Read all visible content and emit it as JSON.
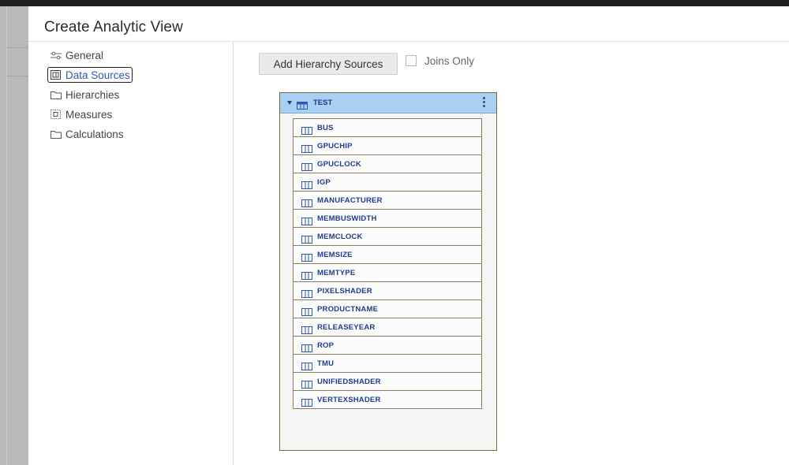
{
  "page": {
    "title": "Create Analytic View"
  },
  "nav": {
    "items": [
      {
        "label": "General",
        "icon": "sliders-icon",
        "active": false
      },
      {
        "label": "Data Sources",
        "icon": "data-sources-icon",
        "active": true
      },
      {
        "label": "Hierarchies",
        "icon": "folder-icon",
        "active": false
      },
      {
        "label": "Measures",
        "icon": "measures-icon",
        "active": false
      },
      {
        "label": "Calculations",
        "icon": "folder-icon",
        "active": false
      }
    ]
  },
  "toolbar": {
    "add_hierarchy_label": "Add Hierarchy Sources",
    "joins_only_label": "Joins Only",
    "joins_only_checked": false
  },
  "source_table": {
    "name": "TEST",
    "menu_icon": "kebab-icon",
    "columns": [
      "BUS",
      "GPUCHIP",
      "GPUCLOCK",
      "IGP",
      "MANUFACTURER",
      "MEMBUSWIDTH",
      "MEMCLOCK",
      "MEMSIZE",
      "MEMTYPE",
      "PIXELSHADER",
      "PRODUCTNAME",
      "RELEASEYEAR",
      "ROP",
      "TMU",
      "UNIFIEDSHADER",
      "VERTEXSHADER"
    ]
  },
  "colors": {
    "header_bg": "#a9d0f2",
    "column_text": "#1f3d8f",
    "panel_border": "#7b6a3a"
  }
}
